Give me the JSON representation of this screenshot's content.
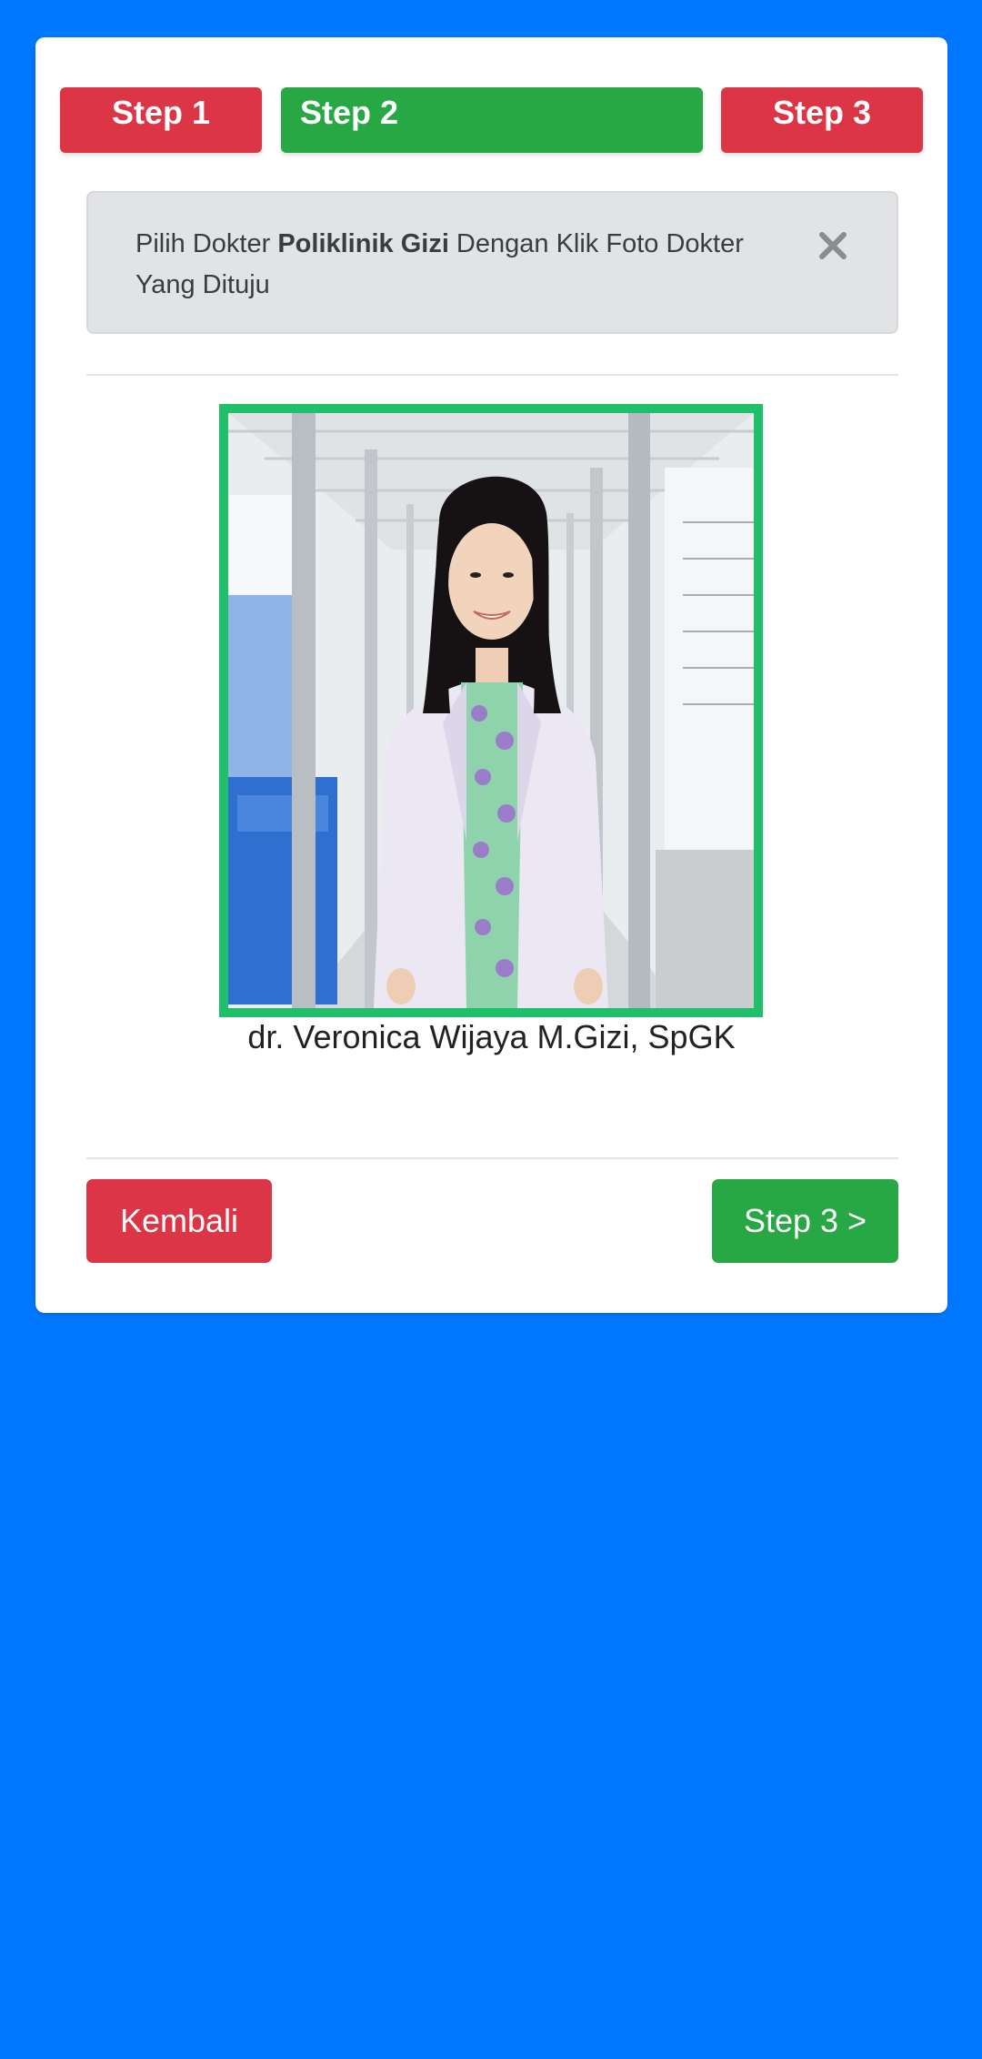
{
  "steps": [
    {
      "label": "Step 1",
      "color": "#dc3545"
    },
    {
      "label": "Step 2",
      "color": "#28a745"
    },
    {
      "label": "Step 3",
      "color": "#dc3545"
    }
  ],
  "alert": {
    "prefix": "Pilih Dokter ",
    "highlight": "Poliklinik Gizi",
    "suffix": " Dengan Klik Foto Dokter Yang Dituju",
    "close_icon": "close-icon"
  },
  "doctor": {
    "name": "dr. Veronica Wijaya M.Gizi, SpGK",
    "selected_border_color": "#20c06a"
  },
  "actions": {
    "back_label": "Kembali",
    "next_label": "Step 3 >"
  },
  "colors": {
    "background": "#0077ff",
    "danger": "#dc3545",
    "success": "#28a745"
  }
}
